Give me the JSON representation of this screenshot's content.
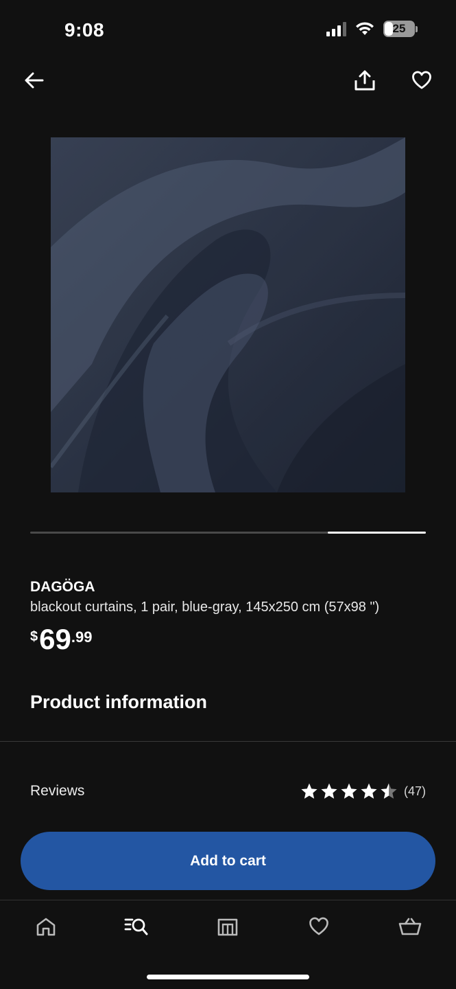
{
  "status_bar": {
    "time": "9:08",
    "battery_level": "25"
  },
  "nav": {
    "back_icon": "arrow-left-icon",
    "share_icon": "share-icon",
    "favorite_icon": "heart-icon"
  },
  "product": {
    "name": "DAGÖGA",
    "description": "blackout curtains, 1 pair, blue-gray, 145x250 cm (57x98 \")",
    "price_currency": "$",
    "price_integer": "69",
    "price_decimal": ".99",
    "image_alt": "blue-gray fabric",
    "carousel_position": 0.75
  },
  "sections": {
    "product_information": "Product information",
    "reviews_label": "Reviews",
    "rating_value": 4.5,
    "rating_max": 5,
    "review_count": "(47)"
  },
  "cta": {
    "add_to_cart": "Add to cart",
    "color": "#2356a3"
  },
  "tabbar": {
    "items": [
      {
        "name": "home",
        "icon": "home-icon"
      },
      {
        "name": "search",
        "icon": "search-list-icon"
      },
      {
        "name": "stores",
        "icon": "store-icon"
      },
      {
        "name": "favourites",
        "icon": "heart-icon"
      },
      {
        "name": "cart",
        "icon": "basket-icon"
      }
    ]
  }
}
